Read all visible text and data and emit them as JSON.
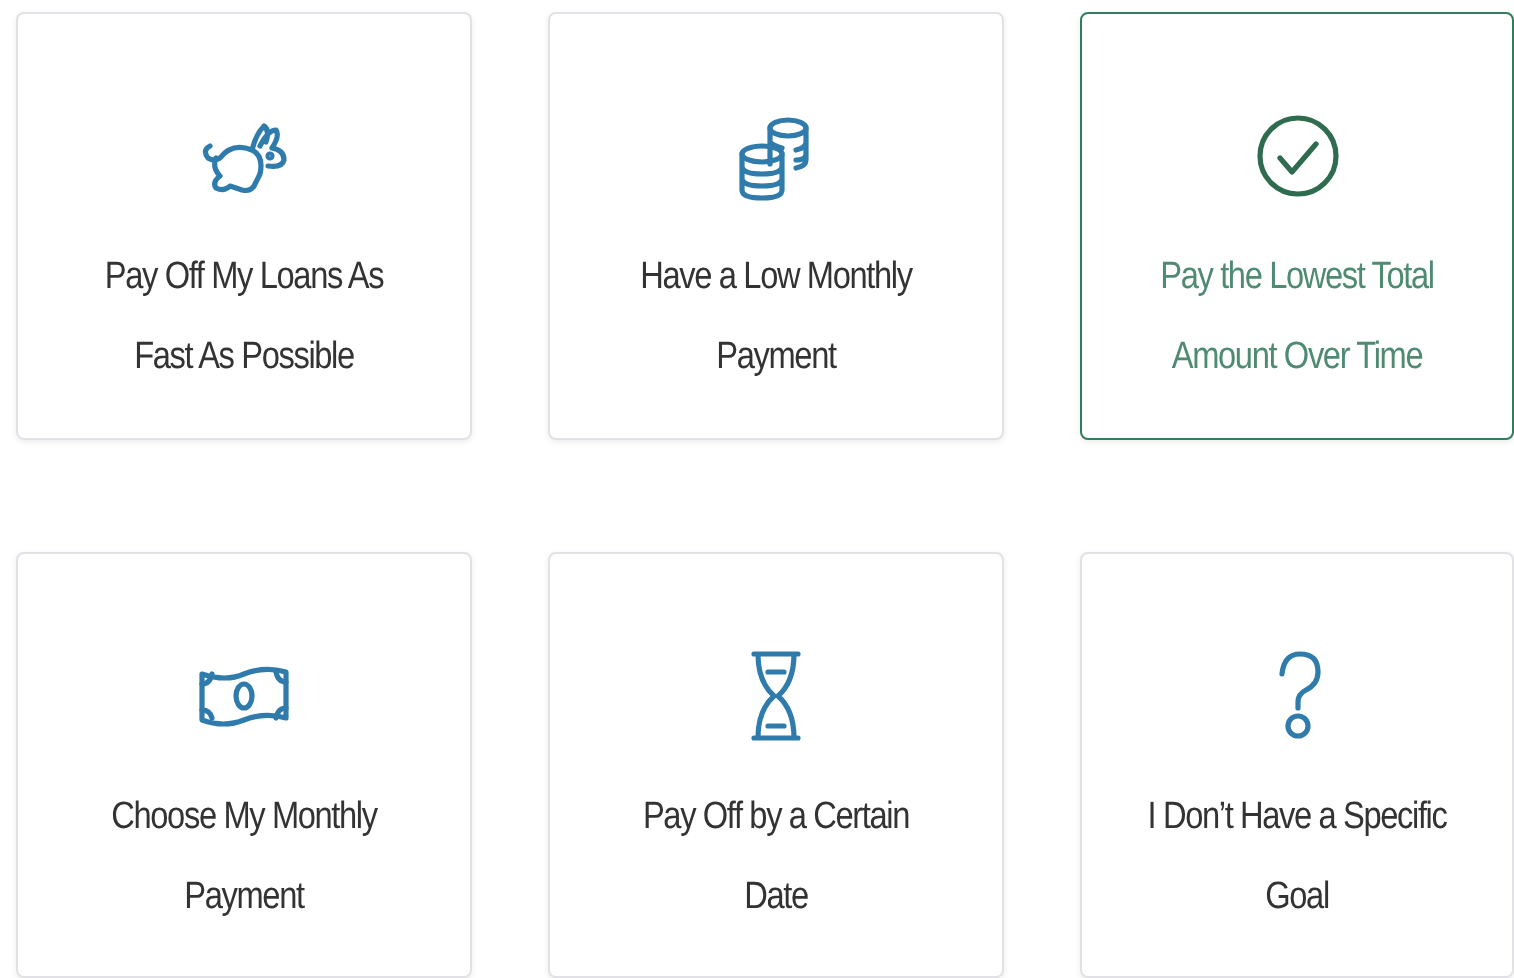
{
  "options": [
    {
      "kind": "rabbit",
      "label": "Pay Off My Loans As Fast As Possible",
      "selected": false
    },
    {
      "kind": "coins",
      "label": "Have a Low Monthly Payment",
      "selected": false
    },
    {
      "kind": "check",
      "label": "Pay the Lowest Total Amount Over Time",
      "selected": true
    },
    {
      "kind": "money",
      "label": "Choose My Monthly Payment",
      "selected": false
    },
    {
      "kind": "hourglass",
      "label": "Pay Off by a Certain Date",
      "selected": false
    },
    {
      "kind": "question",
      "label": "I Don’t Have a Specific Goal",
      "selected": false
    }
  ]
}
